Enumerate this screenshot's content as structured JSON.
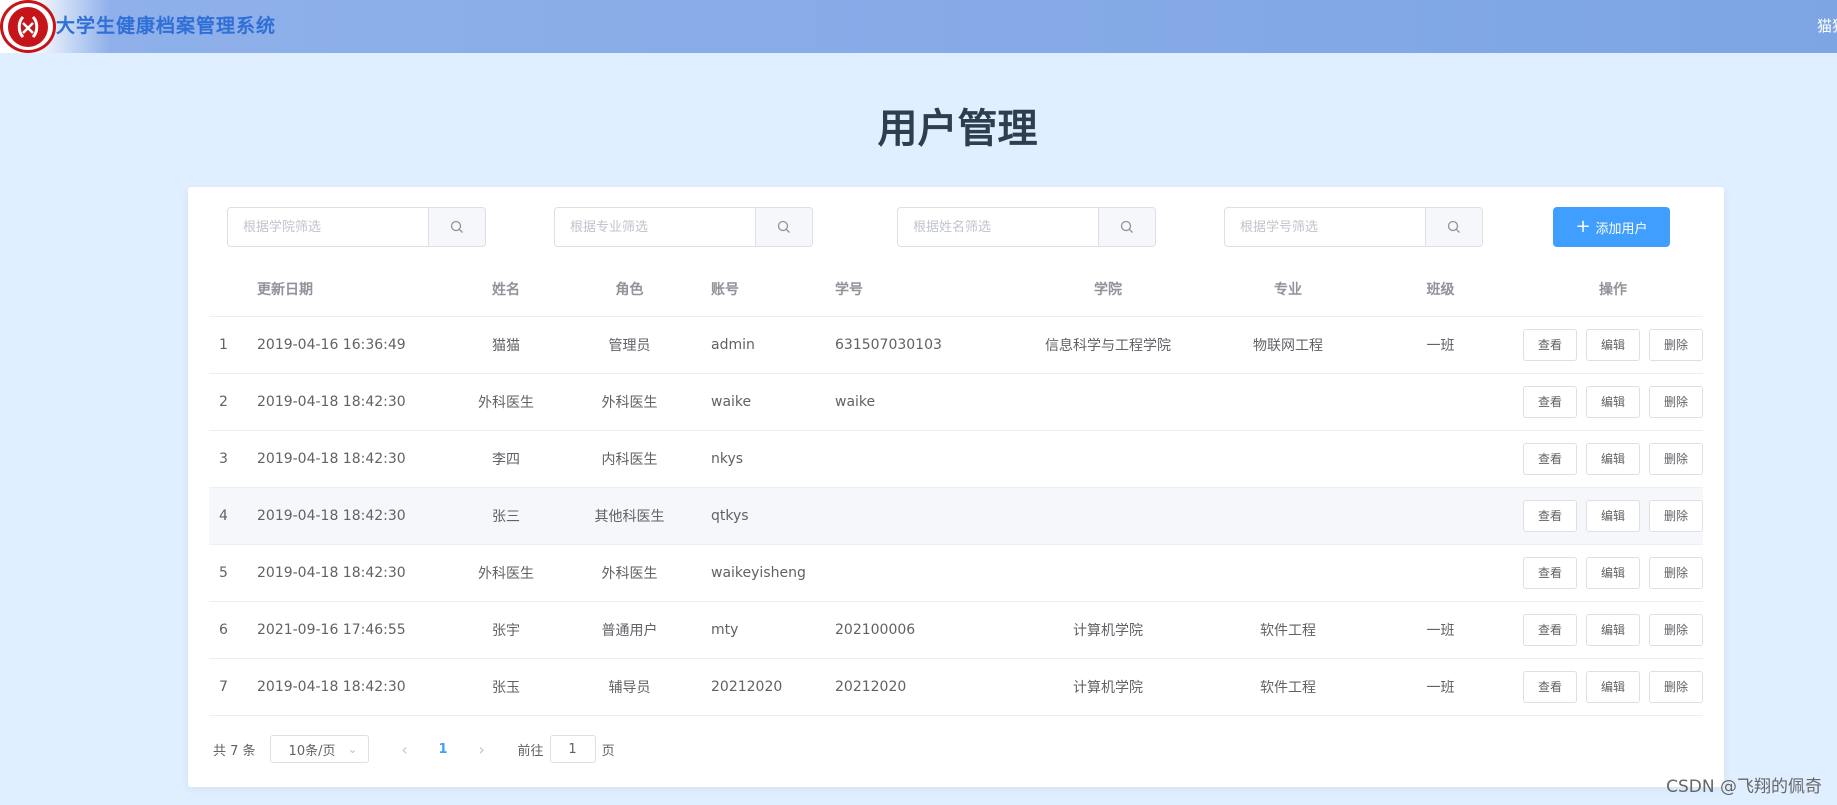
{
  "app": {
    "title": "大学生健康档案管理系统",
    "user": "猫猫"
  },
  "page": {
    "title": "用户管理"
  },
  "filters": [
    {
      "placeholder": "根据学院筛选"
    },
    {
      "placeholder": "根据专业筛选"
    },
    {
      "placeholder": "根据姓名筛选"
    },
    {
      "placeholder": "根据学号筛选"
    }
  ],
  "toolbar": {
    "add_label": "添加用户"
  },
  "table": {
    "columns": [
      "",
      "更新日期",
      "姓名",
      "角色",
      "账号",
      "学号",
      "学院",
      "专业",
      "班级",
      "操作"
    ],
    "actions": {
      "view": "查看",
      "edit": "编辑",
      "delete": "删除"
    },
    "rows": [
      [
        "1",
        "2019-04-16 16:36:49",
        "猫猫",
        "管理员",
        "admin",
        "631507030103",
        "信息科学与工程学院",
        "物联网工程",
        "一班"
      ],
      [
        "2",
        "2019-04-18 18:42:30",
        "外科医生",
        "外科医生",
        "waike",
        "waike",
        "",
        "",
        ""
      ],
      [
        "3",
        "2019-04-18 18:42:30",
        "李四",
        "内科医生",
        "nkys",
        "",
        "",
        "",
        ""
      ],
      [
        "4",
        "2019-04-18 18:42:30",
        "张三",
        "其他科医生",
        "qtkys",
        "",
        "",
        "",
        ""
      ],
      [
        "5",
        "2019-04-18 18:42:30",
        "外科医生",
        "外科医生",
        "waikeyisheng",
        "",
        "",
        "",
        ""
      ],
      [
        "6",
        "2021-09-16 17:46:55",
        "张宇",
        "普通用户",
        "mty",
        "202100006",
        "计算机学院",
        "软件工程",
        "一班"
      ],
      [
        "7",
        "2019-04-18 18:42:30",
        "张玉",
        "辅导员",
        "20212020",
        "20212020",
        "计算机学院",
        "软件工程",
        "一班"
      ]
    ]
  },
  "pagination": {
    "total": "共 7 条",
    "page_size": "10条/页",
    "current_page": "1",
    "goto_prefix": "前往",
    "goto_value": "1",
    "goto_suffix": "页"
  },
  "watermark": "CSDN @飞翔的佩奇"
}
